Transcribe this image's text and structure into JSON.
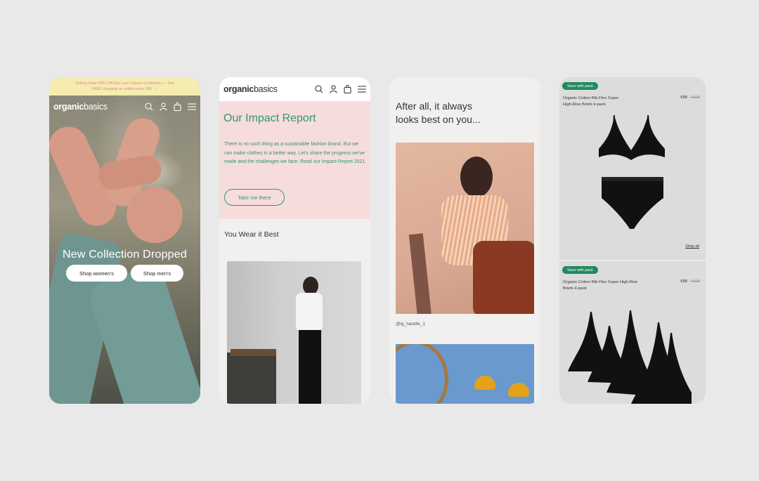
{
  "phone1": {
    "banner_line1": "Selling Fast! 50% Off Our Last Chance Collection — Get",
    "banner_line2": "FREE shipping on orders over €85",
    "banner_arrow": "→",
    "logo_bold": "organic",
    "logo_thin": "basics",
    "hero_title": "New Collection Dropped",
    "btn_women": "Shop women's",
    "btn_men": "Shop men's"
  },
  "phone2": {
    "logo_bold": "organic",
    "logo_thin": "basics",
    "title": "Our Impact Report",
    "body": "There is no such thing as a sustainable fashion brand. But we can make clothes in a better way. Let's share the progress we've made and the challenges we face. Read our Impact Report 2021.",
    "cta": "Take me there",
    "section_title": "You Wear it Best"
  },
  "phone3": {
    "headline_line1": "After all, it always",
    "headline_line2": "looks best on you...",
    "handle": "@ig_handle_1"
  },
  "phone4": {
    "products": [
      {
        "badge": "Save with pack",
        "name_line1": "Organic Cotton Rib-Flex Super",
        "name_line2": "High-Rise Briefs 4-pack",
        "price": "€88",
        "old_price": "€108",
        "link": "Shop all"
      },
      {
        "badge": "Save with pack",
        "name_line1": "Organic Cotton Rib-Flex Super High-Rise",
        "name_line2": "Briefs 4-pack",
        "price": "€88",
        "old_price": "€108"
      }
    ]
  },
  "colors": {
    "background": "#e9e9e9",
    "brand_green": "#2a9a6d",
    "badge_green": "#1f8a5e",
    "impact_pink": "#f7dcdc",
    "banner_yellow": "#f5edb0",
    "banner_pink_text": "#e07a9c"
  },
  "icons": [
    "search-icon",
    "account-icon",
    "bag-icon",
    "menu-icon",
    "arrow-right-icon"
  ]
}
